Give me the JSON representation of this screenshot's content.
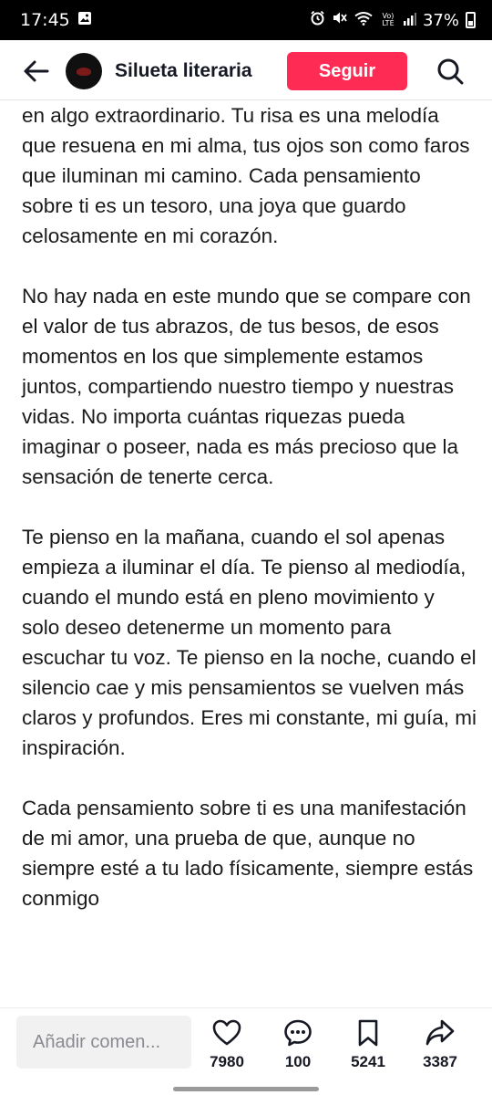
{
  "status_bar": {
    "time": "17:45",
    "network": "Vo) LTE",
    "battery": "37%",
    "icons": [
      "gallery-icon",
      "alarm-icon",
      "mute-icon",
      "wifi-icon",
      "signal-icon"
    ]
  },
  "header": {
    "account_name": "Silueta literaria",
    "follow_label": "Seguir",
    "icons": [
      "back-arrow-icon",
      "search-icon"
    ]
  },
  "article": {
    "paragraphs": [
      "en algo extraordinario. Tu risa es una melodía que resuena en mi alma, tus ojos son como faros que iluminan mi camino. Cada pensamiento sobre ti es un tesoro, una joya que guardo celosamente en mi corazón.",
      "No hay nada en este mundo que se compare con el valor de tus abrazos, de tus besos, de esos momentos en los que simplemente estamos juntos, compartiendo nuestro tiempo y nuestras vidas. No importa cuántas riquezas pueda imaginar o poseer, nada es más precioso que la sensación de tenerte cerca.",
      "Te pienso en la mañana, cuando el sol apenas empieza a iluminar el día. Te pienso al mediodía, cuando el mundo está en pleno movimiento y solo deseo detenerme un momento para escuchar tu voz. Te pienso en la noche, cuando el silencio cae y mis pensamientos se vuelven más claros y profundos. Eres mi constante, mi guía, mi inspiración.",
      "Cada pensamiento sobre ti es una manifestación de mi amor, una prueba de que, aunque no siempre esté a tu lado físicamente, siempre estás conmigo"
    ]
  },
  "bottom_bar": {
    "comment_placeholder": "Añadir comen...",
    "likes": "7980",
    "comments": "100",
    "saves": "5241",
    "shares": "3387"
  },
  "colors": {
    "accent": "#fe2c55",
    "text": "#1a1a1a",
    "status_bar": "#000000"
  }
}
